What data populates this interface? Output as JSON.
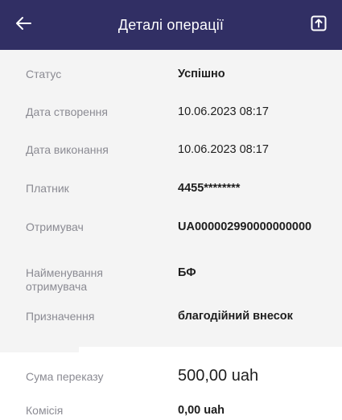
{
  "header": {
    "title": "Деталі операції",
    "back_icon": "arrow-left-icon",
    "share_icon": "share-upload-icon",
    "background": "#312f64"
  },
  "details": [
    {
      "label": "Статус",
      "value": "Успішно"
    },
    {
      "label": "Дата створення",
      "value": "10.06.2023 08:17"
    },
    {
      "label": "Дата виконання",
      "value": "10.06.2023 08:17"
    },
    {
      "label": "Платник",
      "value": "4455********"
    },
    {
      "label": "Отримувач",
      "value": "UA000002990000000000"
    },
    {
      "label": "Найменування отримувача",
      "value": "БФ"
    },
    {
      "label": "Призначення",
      "value": "благодійний внесок"
    }
  ],
  "summary": {
    "amount_label": "Сума переказу",
    "amount_value": "500,00 uah",
    "fee_label": "Комісія",
    "fee_value": "0,00 uah"
  }
}
